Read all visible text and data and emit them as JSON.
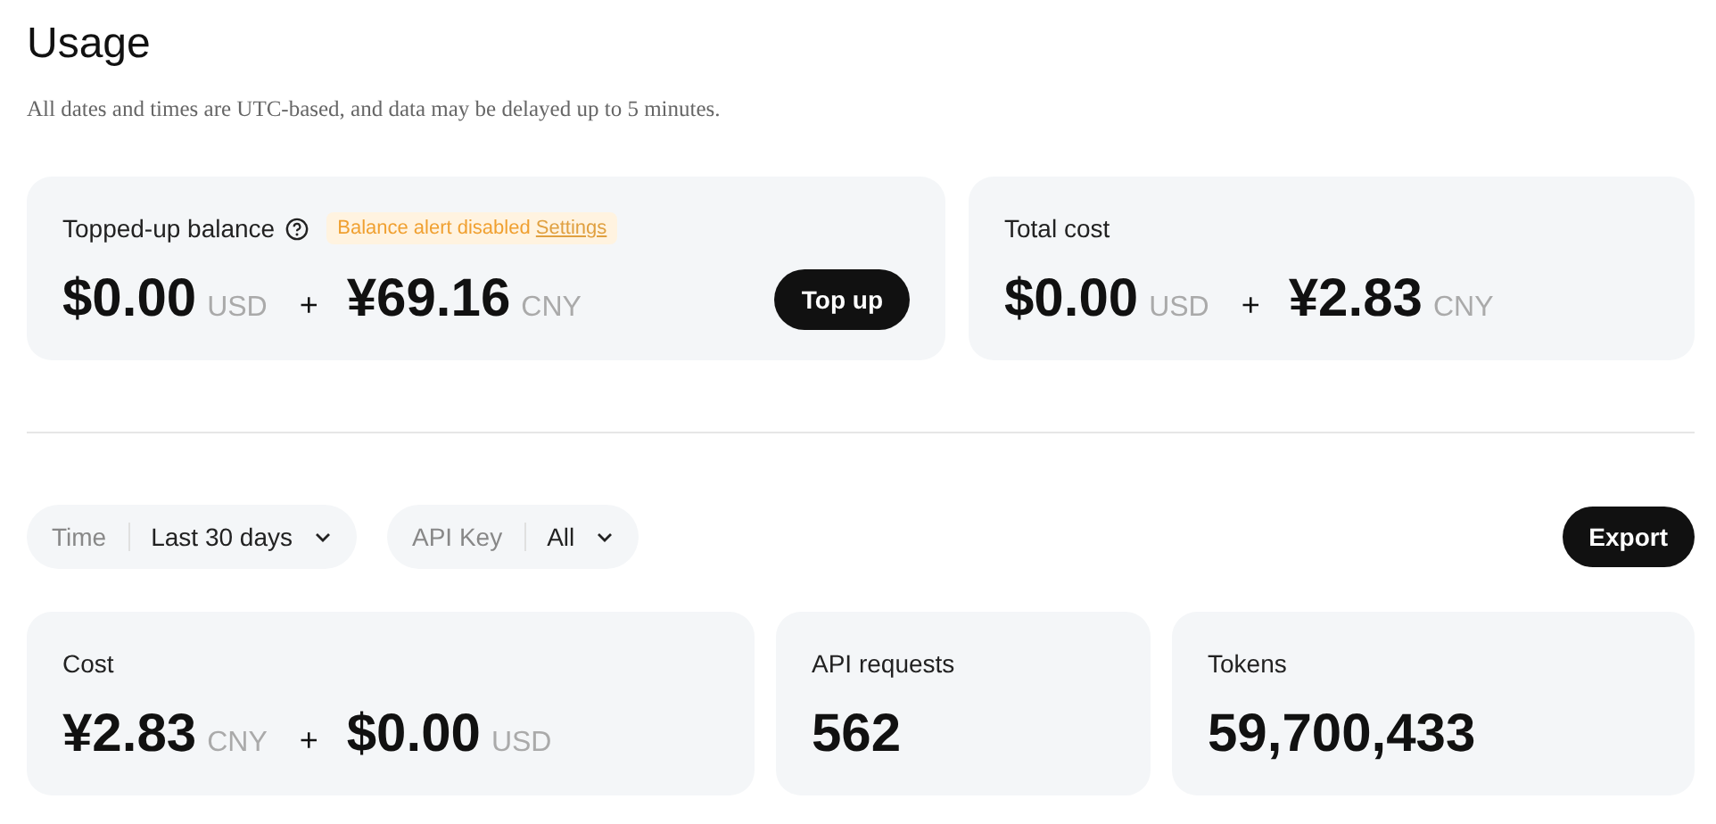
{
  "title": "Usage",
  "subtitle": "All dates and times are UTC-based, and data may be delayed up to 5 minutes.",
  "balance_card": {
    "label": "Topped-up balance",
    "alert": "Balance alert disabled",
    "alert_link": "Settings",
    "amounts": [
      {
        "amount": "$0.00",
        "currency": "USD"
      },
      {
        "amount": "¥69.16",
        "currency": "CNY"
      }
    ],
    "separator": "+",
    "button": "Top up"
  },
  "total_cost_card": {
    "label": "Total cost",
    "amounts": [
      {
        "amount": "$0.00",
        "currency": "USD"
      },
      {
        "amount": "¥2.83",
        "currency": "CNY"
      }
    ],
    "separator": "+"
  },
  "filters": [
    {
      "label": "Time",
      "value": "Last 30 days"
    },
    {
      "label": "API Key",
      "value": "All"
    }
  ],
  "export_button": "Export",
  "stats": [
    {
      "label": "Cost",
      "amounts": [
        {
          "amount": "¥2.83",
          "currency": "CNY"
        },
        {
          "amount": "$0.00",
          "currency": "USD"
        }
      ],
      "separator": "+"
    },
    {
      "label": "API requests",
      "value": "562"
    },
    {
      "label": "Tokens",
      "value": "59,700,433"
    }
  ]
}
